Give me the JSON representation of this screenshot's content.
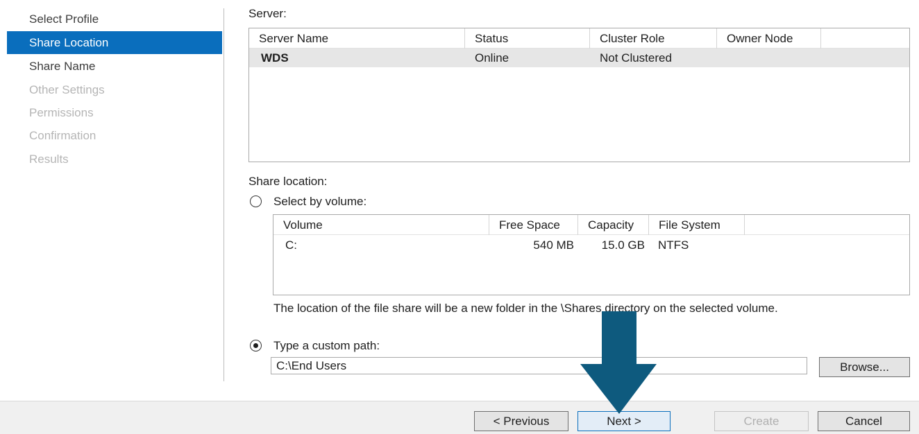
{
  "nav": {
    "items": [
      {
        "label": "Select Profile",
        "state": "done"
      },
      {
        "label": "Share Location",
        "state": "active"
      },
      {
        "label": "Share Name",
        "state": "done"
      },
      {
        "label": "Other Settings",
        "state": "pending"
      },
      {
        "label": "Permissions",
        "state": "pending"
      },
      {
        "label": "Confirmation",
        "state": "pending"
      },
      {
        "label": "Results",
        "state": "pending"
      }
    ]
  },
  "server": {
    "label": "Server:",
    "columns": [
      "Server Name",
      "Status",
      "Cluster Role",
      "Owner Node"
    ],
    "rows": [
      {
        "server_name": "WDS",
        "status": "Online",
        "cluster_role": "Not Clustered",
        "owner_node": ""
      }
    ]
  },
  "share_location": {
    "label": "Share location:",
    "by_volume": {
      "label": "Select by volume:",
      "selected": false,
      "columns": [
        "Volume",
        "Free Space",
        "Capacity",
        "File System"
      ],
      "rows": [
        {
          "volume": "C:",
          "free_space": "540 MB",
          "capacity": "15.0 GB",
          "file_system": "NTFS"
        }
      ],
      "note": "The location of the file share will be a new folder in the \\Shares directory on the selected volume."
    },
    "custom_path": {
      "label": "Type a custom path:",
      "selected": true,
      "value": "C:\\End Users",
      "browse_label": "Browse..."
    }
  },
  "footer": {
    "previous_label": "< Previous",
    "next_label": "Next >",
    "create_label": "Create",
    "cancel_label": "Cancel"
  },
  "colors": {
    "accent": "#0a6ebd",
    "arrow": "#0e5a7e"
  }
}
